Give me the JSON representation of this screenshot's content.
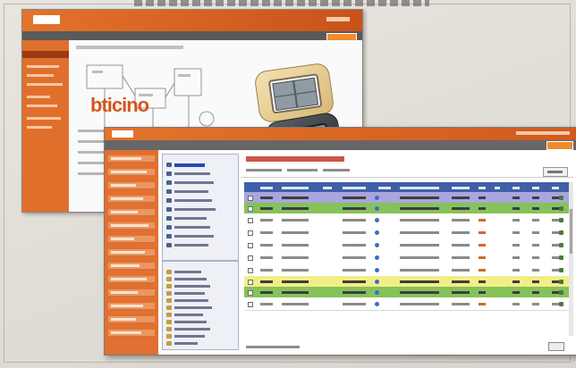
{
  "back_window": {
    "brand": "bticino",
    "logo_text": "bticino"
  },
  "front_window": {
    "logo_text": "bticino",
    "sidebar_items": 14,
    "tree": {
      "upper_items": 10,
      "lower_items": 11
    },
    "table": {
      "rows": [
        {
          "color": "#3f5fa8",
          "kind": "header"
        },
        {
          "color": "#a9a6df",
          "kind": "group"
        },
        {
          "color": "#86c25a",
          "kind": "group"
        },
        {
          "color": "#ffffff",
          "kind": "item"
        },
        {
          "color": "#ffffff",
          "kind": "item"
        },
        {
          "color": "#ffffff",
          "kind": "item"
        },
        {
          "color": "#ffffff",
          "kind": "item"
        },
        {
          "color": "#ffffff",
          "kind": "item"
        },
        {
          "color": "#f2ee86",
          "kind": "group"
        },
        {
          "color": "#86c25a",
          "kind": "group"
        },
        {
          "color": "#ffffff",
          "kind": "item"
        }
      ]
    }
  },
  "colors": {
    "brand_orange": "#e4732c",
    "header_blue": "#3f5fa8",
    "lavender_row": "#a9a6df",
    "green_row": "#86c25a",
    "yellow_row": "#f2ee86"
  }
}
